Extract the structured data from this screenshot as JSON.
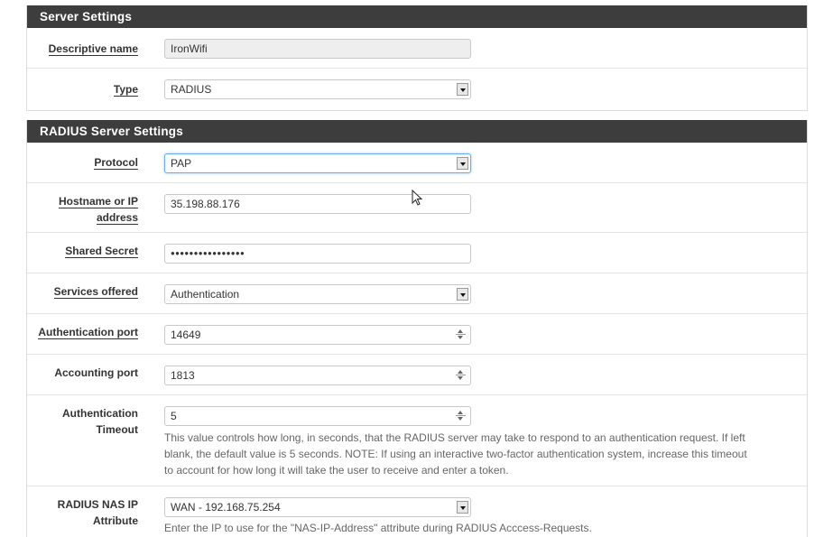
{
  "server_settings": {
    "heading": "Server Settings",
    "descriptive_name": {
      "label": "Descriptive name",
      "value": "IronWifi"
    },
    "type": {
      "label": "Type",
      "value": "RADIUS"
    }
  },
  "radius_settings": {
    "heading": "RADIUS Server Settings",
    "protocol": {
      "label": "Protocol",
      "value": "PAP"
    },
    "hostname": {
      "label_line1": "Hostname or IP",
      "label_line2": "address",
      "value": "35.198.88.176"
    },
    "shared_secret": {
      "label": "Shared Secret",
      "value": "●●●●●●●●●●●●●●●●"
    },
    "services": {
      "label": "Services offered",
      "value": "Authentication"
    },
    "auth_port": {
      "label": "Authentication port",
      "value": "14649"
    },
    "acct_port": {
      "label": "Accounting port",
      "value": "1813"
    },
    "auth_timeout": {
      "label_line1": "Authentication",
      "label_line2": "Timeout",
      "value": "5",
      "help_line1": "This value controls how long, in seconds, that the RADIUS server may take to respond to an authentication request. If left",
      "help_line2": "blank, the default value is 5 seconds. NOTE: If using an interactive two-factor authentication system, increase this timeout",
      "help_line3": "to account for how long it will take the user to receive and enter a token."
    },
    "nas_ip": {
      "label_line1": "RADIUS NAS IP",
      "label_line2": "Attribute",
      "value": "WAN - 192.168.75.254",
      "help_line1": "Enter the IP to use for the \"NAS-IP-Address\" attribute during RADIUS Acccess-Requests."
    }
  },
  "icons": {
    "select_arrow": "chevron-down-icon",
    "spinner": "spinner-icon",
    "cursor": "mouse-cursor-icon"
  },
  "colors": {
    "heading_bg": "#3d3d3d",
    "heading_text": "#ffffff",
    "focus_border": "#66afe9",
    "readonly_bg": "#eeeeee"
  }
}
